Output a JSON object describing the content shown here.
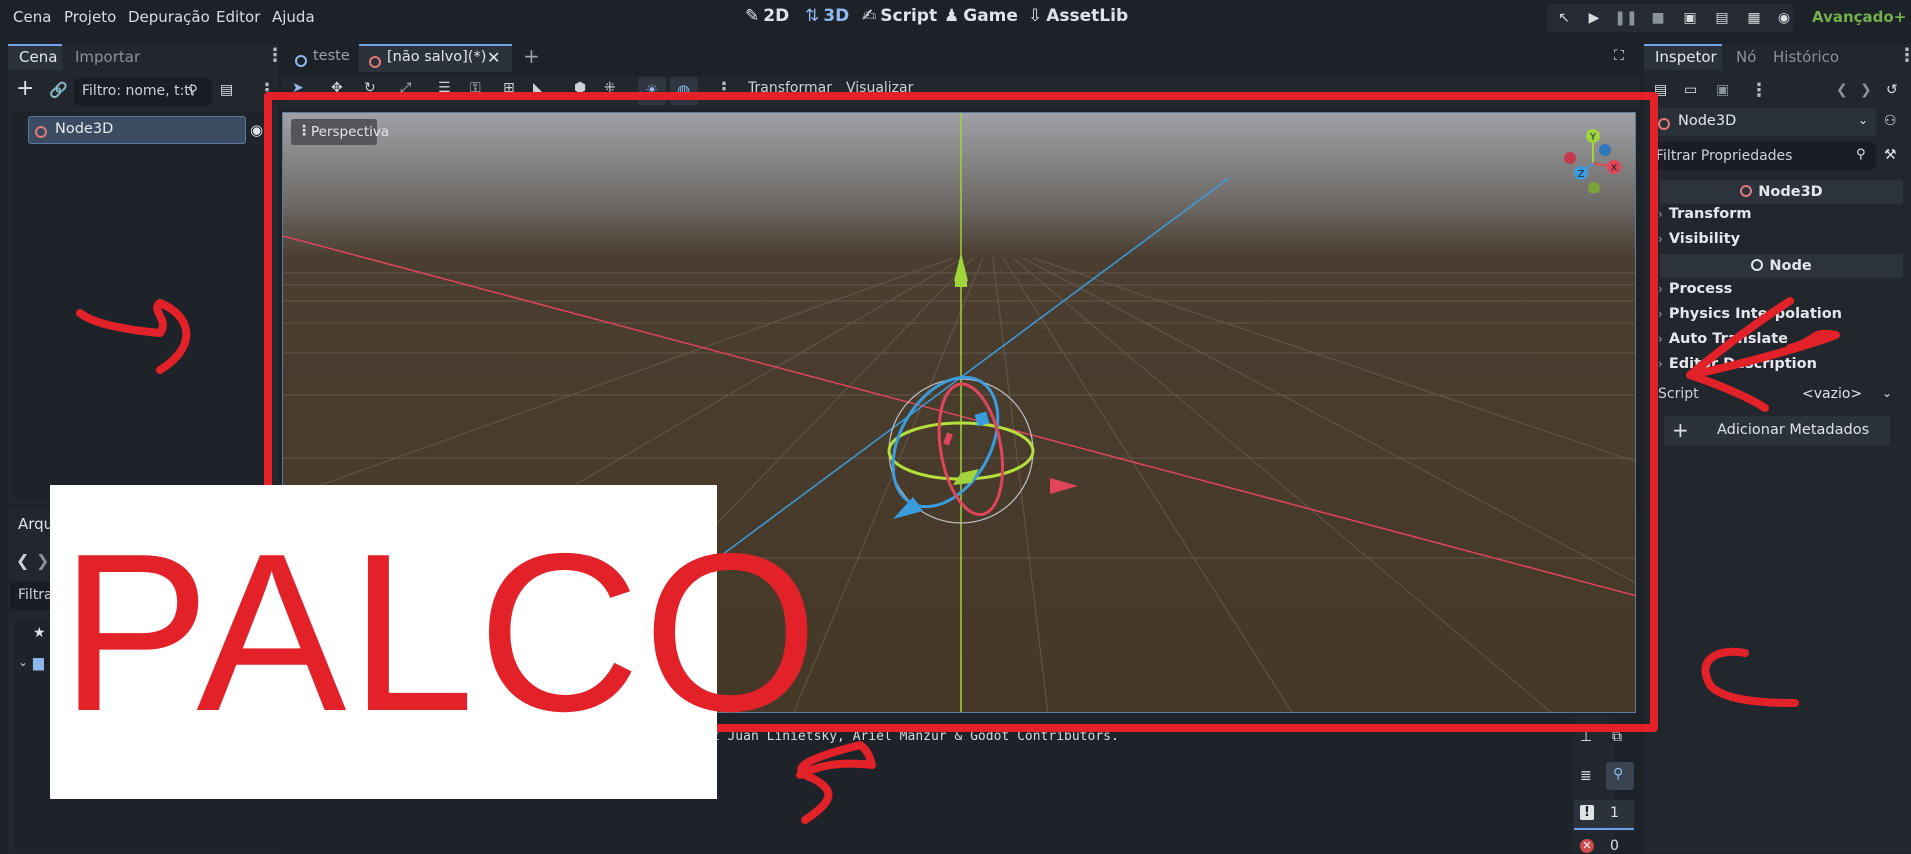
{
  "menubar": {
    "items": [
      "Cena",
      "Projeto",
      "Depuração",
      "Editor",
      "Ajuda"
    ],
    "modes": [
      {
        "label": "2D",
        "icon": "2d-icon",
        "active": false
      },
      {
        "label": "3D",
        "icon": "3d-icon",
        "active": true
      },
      {
        "label": "Script",
        "icon": "script-icon",
        "active": false
      },
      {
        "label": "Game",
        "icon": "game-icon",
        "active": false
      },
      {
        "label": "AssetLib",
        "icon": "assetlib-icon",
        "active": false
      }
    ],
    "renderer": "Avançado+"
  },
  "scene_dock": {
    "tabs": [
      "Cena",
      "Importar"
    ],
    "filter_placeholder": "Filtro: nome, t:ti",
    "root_node": "Node3D"
  },
  "filesystem_dock": {
    "tab": "Arqu",
    "filter_text": "Filtra"
  },
  "editor_tabs": {
    "tabs": [
      "teste",
      "[não salvo](*)"
    ]
  },
  "viewport_toolbar": {
    "menus": [
      "Transformar",
      "Visualizar"
    ]
  },
  "viewport": {
    "perspective_label": "Perspectiva",
    "gizmo_axes": [
      "Y",
      "Z",
      "X"
    ]
  },
  "output": {
    "log_line": "nt Juan Linietsky, Ariel Manzur & Godot Contributors.",
    "warnings_count": "1",
    "errors_count": "0"
  },
  "inspector": {
    "tabs": [
      "Inspetor",
      "Nó",
      "Histórico"
    ],
    "node_selector": "Node3D",
    "filter_placeholder": "Filtrar Propriedades",
    "class_header": "Node3D",
    "sections_node3d": [
      "Transform",
      "Visibility"
    ],
    "node_header": "Node",
    "sections_node": [
      "Process",
      "Physics Interpolation",
      "Auto Translate",
      "Editor Description"
    ],
    "script_label": "Script",
    "script_value": "<vazio>",
    "add_metadata": "Adicionar Metadados"
  },
  "annotation": {
    "label": "PALCO",
    "color": "#e32128"
  }
}
